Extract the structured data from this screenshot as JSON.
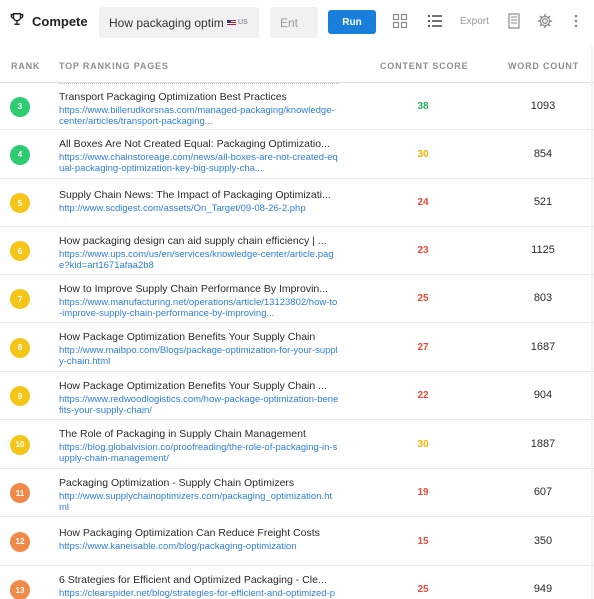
{
  "app": {
    "title": "Compete"
  },
  "search": {
    "query": "How packaging optimization",
    "country": "US",
    "entity_placeholder": "Ent"
  },
  "toolbar": {
    "run_label": "Run",
    "export_label": "Export"
  },
  "icons": {
    "brand": "trophy-icon",
    "grid_view": "grid-icon",
    "list_view": "list-icon",
    "document": "document-icon",
    "settings": "gear-icon",
    "more": "more-vertical-icon"
  },
  "table": {
    "headers": {
      "rank": "RANK",
      "pages": "TOP RANKING PAGES",
      "score": "CONTENT SCORE",
      "words": "WORD COUNT"
    },
    "rows": [
      {
        "rank": "3",
        "title": "Transport Packaging Optimization Best Practices",
        "url": "https://www.billerudkorsnas.com/managed-packaging/knowledge-center/articles/transport-packaging...",
        "score": "38",
        "words": "1093",
        "badge_color": "#2ecc71",
        "score_color": "#27ae60"
      },
      {
        "rank": "4",
        "title": "All Boxes Are Not Created Equal: Packaging Optimizatio...",
        "url": "https://www.chainstoreage.com/news/all-boxes-are-not-created-equal-packaging-optimization-key-big-supply-cha...",
        "score": "30",
        "words": "854",
        "badge_color": "#2ecc71",
        "score_color": "#f0b400"
      },
      {
        "rank": "5",
        "title": "Supply Chain News: The Impact of Packaging Optimizati...",
        "url": "http://www.scdigest.com/assets/On_Target/09-08-26-2.php",
        "score": "24",
        "words": "521",
        "badge_color": "#f5c518",
        "score_color": "#e74c3c"
      },
      {
        "rank": "6",
        "title": "How packaging design can aid supply chain efficiency | ...",
        "url": "https://www.ups.com/us/en/services/knowledge-center/article.page?kid=art1671afaa2b8",
        "score": "23",
        "words": "1125",
        "badge_color": "#f5c518",
        "score_color": "#e74c3c"
      },
      {
        "rank": "7",
        "title": "How to Improve Supply Chain Performance By Improvin...",
        "url": "https://www.manufacturing.net/operations/article/13123802/how-to-improve-supply-chain-performance-by-improving...",
        "score": "25",
        "words": "803",
        "badge_color": "#f5c518",
        "score_color": "#e74c3c"
      },
      {
        "rank": "8",
        "title": "How Package Optimization Benefits Your Supply Chain",
        "url": "http://www.maibpo.com/Blogs/package-optimization-for-your-supply-chain.html",
        "score": "27",
        "words": "1687",
        "badge_color": "#f5c518",
        "score_color": "#e74c3c"
      },
      {
        "rank": "9",
        "title": "How Package Optimization Benefits Your Supply Chain ...",
        "url": "https://www.redwoodlogistics.com/how-package-optimization-benefits-your-supply-chain/",
        "score": "22",
        "words": "904",
        "badge_color": "#f5c518",
        "score_color": "#e74c3c"
      },
      {
        "rank": "10",
        "title": "The Role of Packaging in Supply Chain Management",
        "url": "https://blog.globalvision.co/proofreading/the-role-of-packaging-in-supply-chain-management/",
        "score": "30",
        "words": "1887",
        "badge_color": "#f5c518",
        "score_color": "#f0b400"
      },
      {
        "rank": "11",
        "title": "Packaging Optimization - Supply Chain Optimizers",
        "url": "http://www.supplychainoptimizers.com/packaging_optimization.html",
        "score": "19",
        "words": "607",
        "badge_color": "#f08a4b",
        "score_color": "#e74c3c"
      },
      {
        "rank": "12",
        "title": "How Packaging Optimization Can Reduce Freight Costs",
        "url": "https://www.kaneisable.com/blog/packaging-optimization",
        "score": "15",
        "words": "350",
        "badge_color": "#f08a4b",
        "score_color": "#e74c3c"
      },
      {
        "rank": "13",
        "title": "6 Strategies for Efficient and Optimized Packaging - Cle...",
        "url": "https://clearspider.net/blog/strategies-for-efficient-and-optimized-packaging/",
        "score": "25",
        "words": "949",
        "badge_color": "#f08a4b",
        "score_color": "#e74c3c"
      }
    ]
  }
}
